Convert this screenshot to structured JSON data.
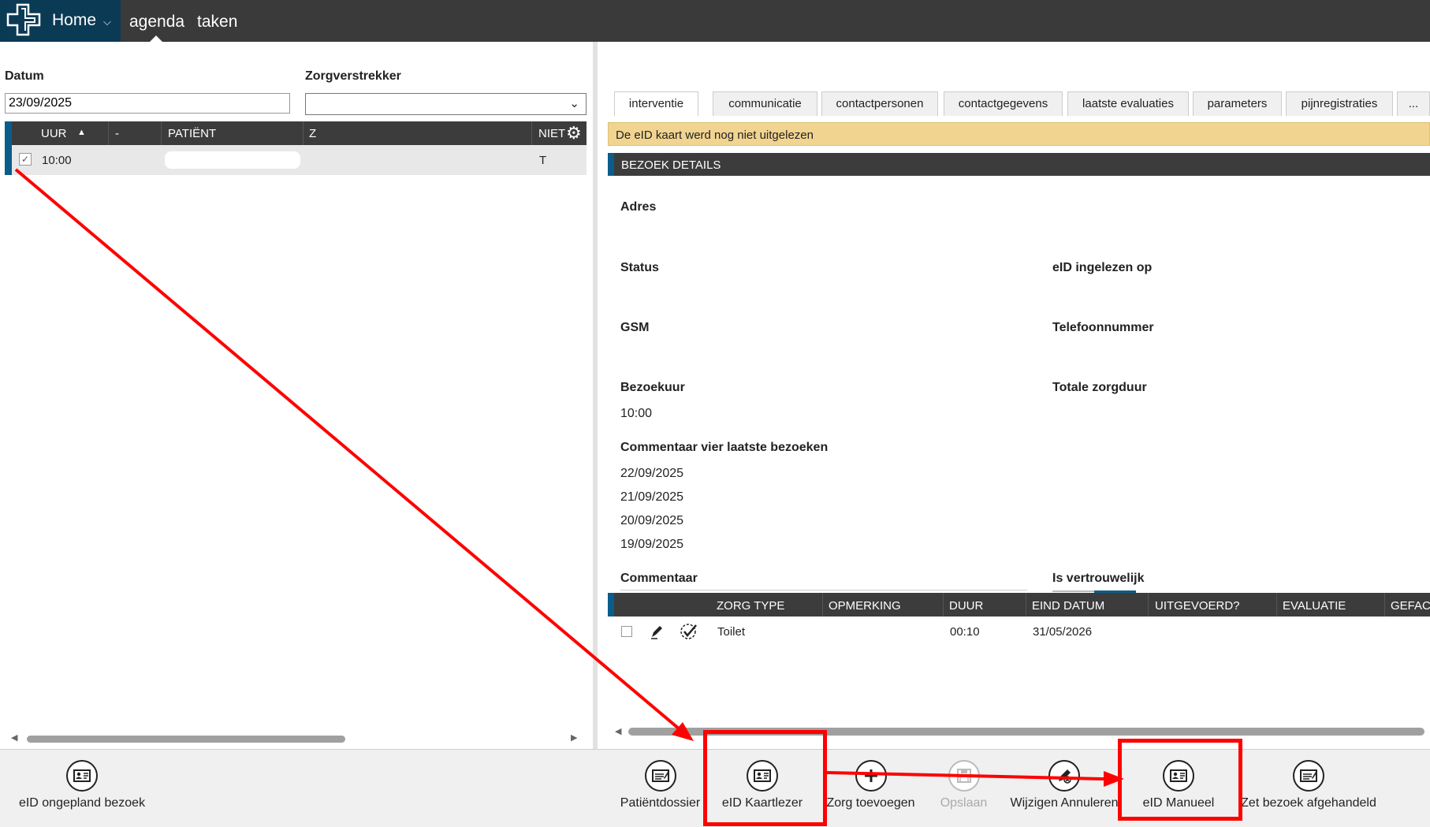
{
  "nav": {
    "home_label": "Home",
    "links": [
      "agenda",
      "taken"
    ],
    "active": "agenda"
  },
  "filters": {
    "datum_label": "Datum",
    "datum_value": "23/09/2025",
    "zorgverstrekker_label": "Zorgverstrekker",
    "zorgverstrekker_value": ""
  },
  "agenda_grid": {
    "columns": [
      "UUR",
      "-",
      "PATIËNT",
      "Z",
      "NIET"
    ],
    "sort_column": "UUR",
    "rows": [
      {
        "checked": true,
        "uur": "10:00",
        "patient": "",
        "z": "",
        "niet": "T"
      }
    ]
  },
  "tabs": [
    "interventie",
    "communicatie",
    "contactpersonen",
    "contactgegevens",
    "laatste evaluaties",
    "parameters",
    "pijnregistraties",
    "..."
  ],
  "active_tab": "interventie",
  "warning": "De eID kaart werd nog niet uitgelezen",
  "section_title": "BEZOEK DETAILS",
  "details": {
    "adres_label": "Adres",
    "status_label": "Status",
    "eid_ingelezen_label": "eID ingelezen op",
    "gsm_label": "GSM",
    "telefoon_label": "Telefoonnummer",
    "bezoekuur_label": "Bezoekuur",
    "bezoekuur_value": "10:00",
    "zorgduur_label": "Totale zorgduur",
    "commentaar_laatste_label": "Commentaar vier laatste bezoeken",
    "laatste_bezoeken": [
      "22/09/2025",
      "21/09/2025",
      "20/09/2025",
      "19/09/2025"
    ],
    "commentaar_label": "Commentaar",
    "vertrouwelijk_label": "Is vertrouwelijk"
  },
  "zorg_grid": {
    "columns": [
      "ZORG TYPE",
      "OPMERKING",
      "DUUR",
      "EIND DATUM",
      "UITGEVOERD?",
      "EVALUATIE",
      "GEFACT"
    ],
    "rows": [
      {
        "zorg_type": "Toilet",
        "opmerking": "",
        "duur": "00:10",
        "eind_datum": "31/05/2026"
      }
    ]
  },
  "toolbar": {
    "eid_ongepland": "eID ongepland bezoek",
    "patientdossier": "Patiëntdossier",
    "eid_kaartlezer": "eID Kaartlezer",
    "zorg_toevoegen": "Zorg toevoegen",
    "opslaan": "Opslaan",
    "wijzigen_annuleren": "Wijzigen Annuleren",
    "eid_manueel": "eID Manueel",
    "zet_afgehandeld": "Zet bezoek afgehandeld"
  },
  "colors": {
    "nav_bg": "#3a3a3a",
    "logo_bg": "#0b3a55",
    "accent": "#0b5c8a",
    "warning_bg": "#f1d490",
    "annotation": "#ff0000"
  }
}
